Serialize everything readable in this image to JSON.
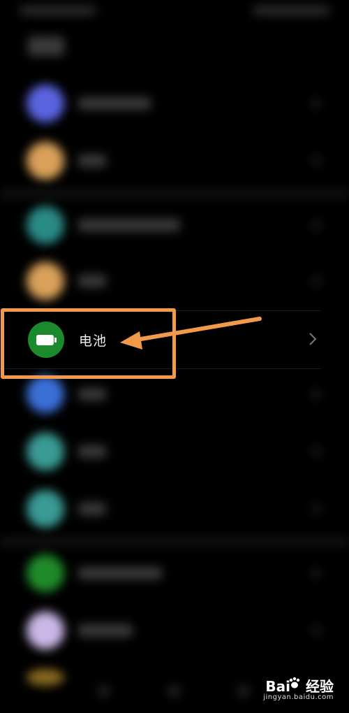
{
  "settings": {
    "rows": [
      {
        "color": "#5a64e0",
        "blurred": true
      },
      {
        "color": "#d9a15a",
        "blurred": true
      },
      {
        "color": "#2a8a86",
        "blurred": true
      },
      {
        "color": "#d9a15a",
        "blurred": true
      },
      {
        "label": "电池",
        "icon": "battery-icon",
        "color": "#1b8a2c",
        "highlighted": true
      },
      {
        "color": "#3a6fd6",
        "blurred": true
      },
      {
        "color": "#3a9a94",
        "blurred": true
      },
      {
        "color": "#3a9a94",
        "blurred": true
      },
      {
        "color": "#1f8a2a",
        "blurred": true
      },
      {
        "color": "#c9b8e6",
        "blurred": true
      }
    ]
  },
  "annotation": {
    "color": "#f39a4a"
  },
  "watermark": {
    "brand": "Bai",
    "brand_suffix": "经验",
    "url": "jingyan.baidu.com"
  }
}
